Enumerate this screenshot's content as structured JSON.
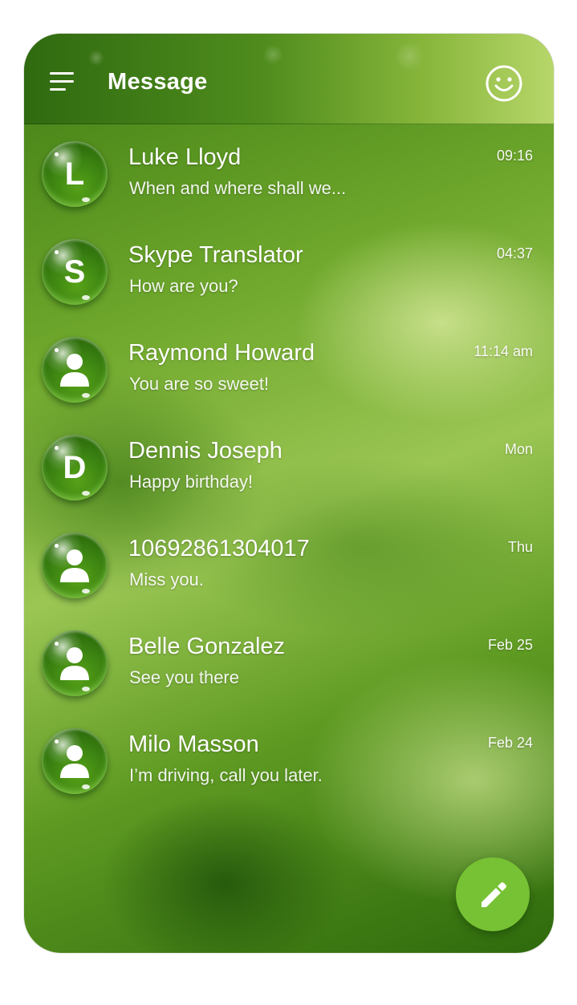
{
  "header": {
    "title": "Message",
    "menu_icon": "menu-icon",
    "action_icon": "smiley-face-icon"
  },
  "conversations": [
    {
      "avatar_type": "letter",
      "avatar_letter": "L",
      "name": "Luke Lloyd",
      "preview": "When and where shall we...",
      "time": "09:16"
    },
    {
      "avatar_type": "letter",
      "avatar_letter": "S",
      "name": "Skype Translator",
      "preview": "How are you?",
      "time": "04:37"
    },
    {
      "avatar_type": "person-icon",
      "avatar_letter": "",
      "name": "Raymond Howard",
      "preview": "You are so sweet!",
      "time": "11:14 am"
    },
    {
      "avatar_type": "letter",
      "avatar_letter": "D",
      "name": "Dennis Joseph",
      "preview": "Happy birthday!",
      "time": "Mon"
    },
    {
      "avatar_type": "person-icon",
      "avatar_letter": "",
      "name": "10692861304017",
      "preview": "Miss you.",
      "time": "Thu"
    },
    {
      "avatar_type": "person-icon",
      "avatar_letter": "",
      "name": "Belle Gonzalez",
      "preview": "See you there",
      "time": "Feb 25"
    },
    {
      "avatar_type": "person-icon",
      "avatar_letter": "",
      "name": "Milo Masson",
      "preview": "I’m driving, call you later.",
      "time": "Feb 24"
    }
  ],
  "fab": {
    "icon": "pencil-icon",
    "color": "#77c234"
  },
  "colors": {
    "accent": "#77c234",
    "avatar_green": "#3c8412",
    "text": "#ffffff"
  }
}
